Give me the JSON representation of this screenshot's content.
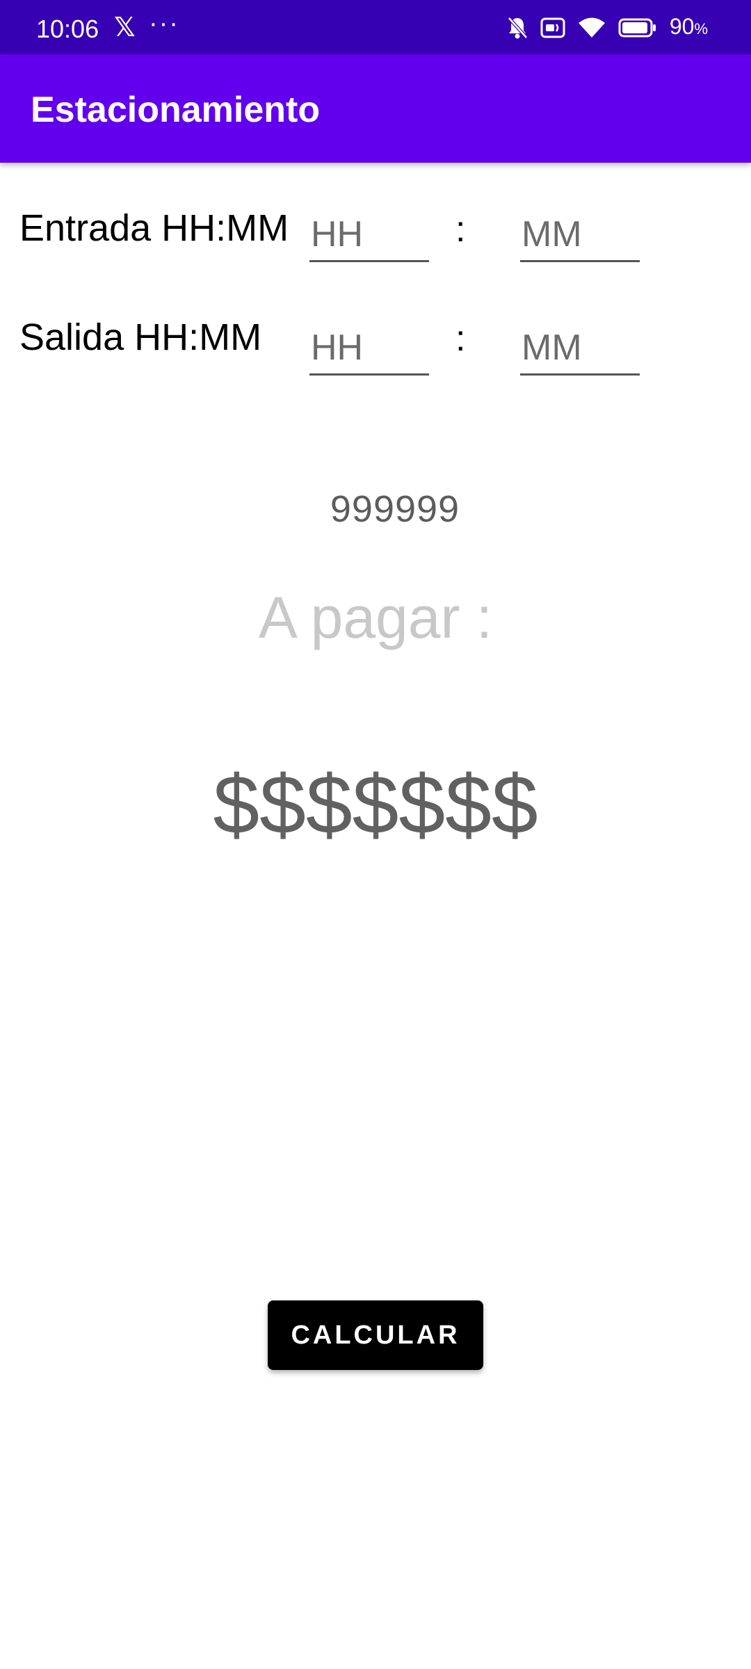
{
  "status_bar": {
    "time": "10:06",
    "battery_value": "90",
    "battery_unit": "%",
    "icons": [
      "x-logo-icon",
      "more-icon",
      "bell-off-icon",
      "nfc-card-icon",
      "wifi-icon",
      "battery-icon"
    ]
  },
  "app_bar": {
    "title": "Estacionamiento",
    "color": "#6200ee"
  },
  "entrada": {
    "label": "Entrada HH:MM",
    "hour_placeholder": "HH",
    "minute_placeholder": "MM",
    "separator": ":"
  },
  "salida": {
    "label": "Salida HH:MM",
    "hour_placeholder": "HH",
    "minute_placeholder": "MM",
    "separator": ":"
  },
  "result": {
    "code": "999999",
    "pay_label": "A pagar :",
    "amount": "$$$$$$$"
  },
  "calcular_button": {
    "label": "CALCULAR"
  },
  "colors": {
    "status_bar": "#3700b3",
    "app_bar": "#6200ee",
    "button": "#000000"
  }
}
